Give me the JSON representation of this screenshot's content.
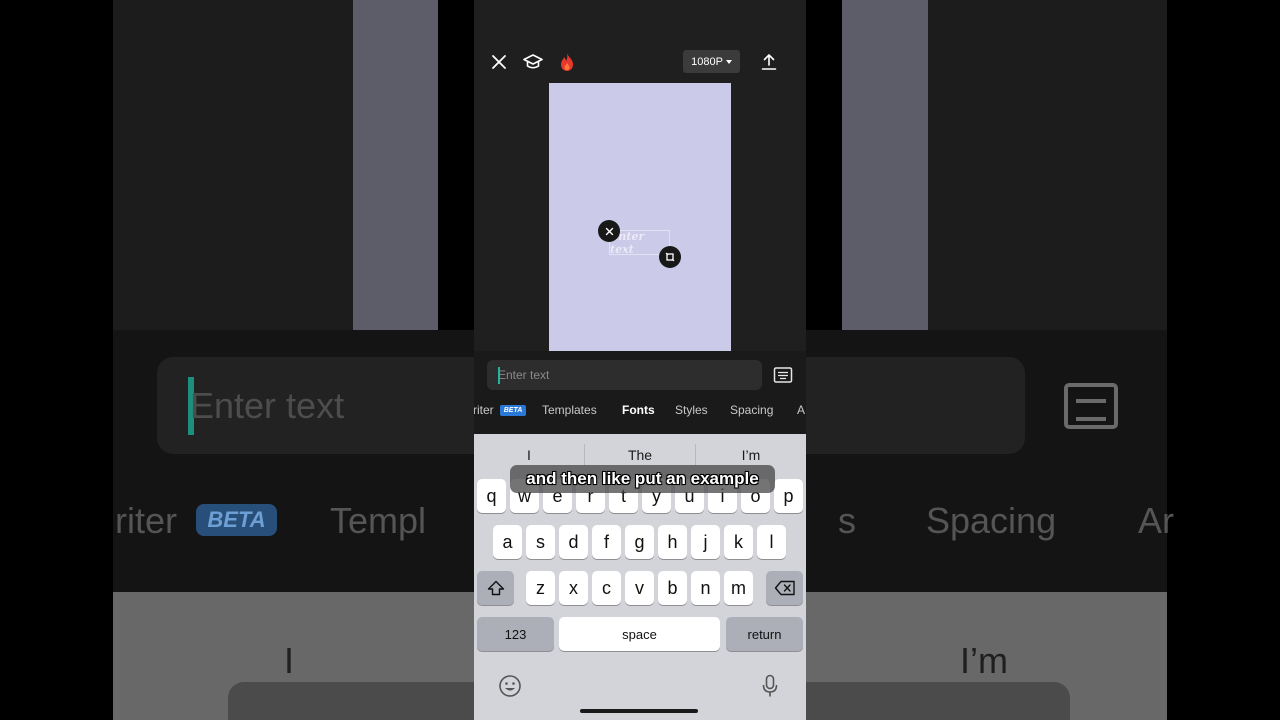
{
  "topbar": {
    "close_icon": "close-icon",
    "learn_icon": "graduation-cap-icon",
    "hot_icon": "flame-icon",
    "resolution_label": "1080P",
    "export_icon": "upload-icon"
  },
  "canvas": {
    "background_color": "#cbcae9",
    "text_box_label": "Enter text"
  },
  "editor": {
    "input_placeholder": "Enter text",
    "keyboard_toggle_icon": "keyboard-icon",
    "tabs": [
      {
        "label": "riter",
        "badge": "BETA"
      },
      {
        "label": "Templates"
      },
      {
        "label": "Fonts",
        "active": true
      },
      {
        "label": "Styles"
      },
      {
        "label": "Spacing"
      },
      {
        "label": "A"
      }
    ]
  },
  "keyboard": {
    "suggestions": [
      "I",
      "The",
      "I’m"
    ],
    "row1": [
      "q",
      "w",
      "e",
      "r",
      "t",
      "y",
      "u",
      "i",
      "o",
      "p"
    ],
    "row2": [
      "a",
      "s",
      "d",
      "f",
      "g",
      "h",
      "j",
      "k",
      "l"
    ],
    "row3": [
      "z",
      "x",
      "c",
      "v",
      "b",
      "n",
      "m"
    ],
    "numbers_label": "123",
    "space_label": "space",
    "return_label": "return",
    "shift_icon": "shift-icon",
    "delete_icon": "backspace-icon",
    "emoji_icon": "emoji-icon",
    "mic_icon": "microphone-icon"
  },
  "caption": {
    "text": "and then like put an example"
  },
  "background": {
    "input_placeholder": "Enter text",
    "tab_partial_1": "riter",
    "tab_badge": "BETA",
    "tab_partial_2": "Templ",
    "tab_partial_3": "s",
    "tab_spacing": "Spacing",
    "tab_partial_4": "Ar",
    "suggestion_1": "I",
    "suggestion_3": "I’m"
  }
}
